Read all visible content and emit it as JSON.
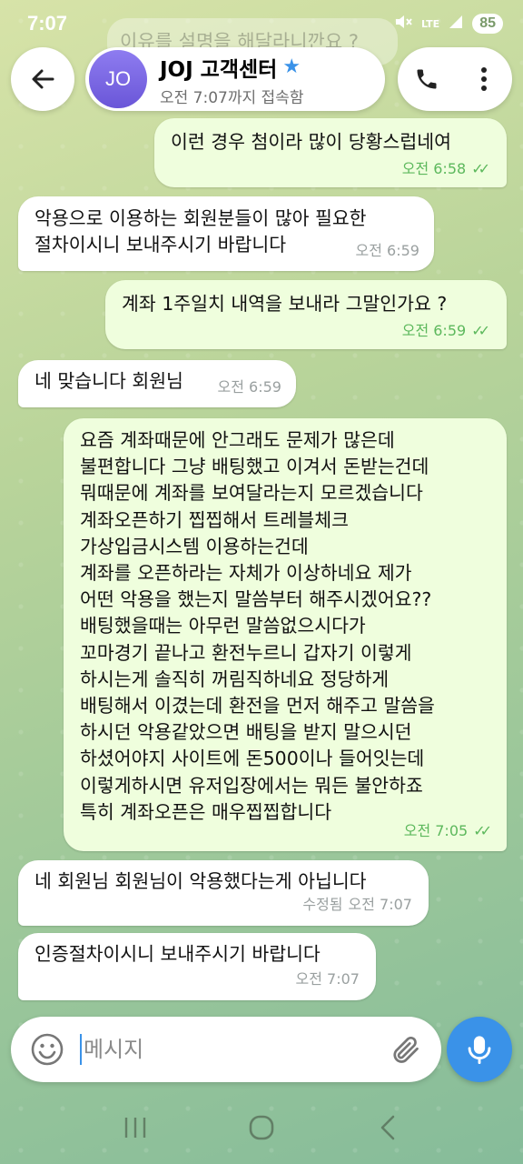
{
  "status_bar": {
    "time": "7:07",
    "network": "LTE",
    "battery": "85"
  },
  "ghost_message": "이유를 설명을 해달라니깐요 ?",
  "header": {
    "avatar_initials": "JO",
    "chat_name": "JOJ 고객센터",
    "chat_status": "오전 7:07까지 접속함",
    "icons": {
      "back": "back-arrow-icon",
      "verified": "star-icon",
      "call": "phone-icon",
      "menu": "more-vertical-icon"
    }
  },
  "messages": [
    {
      "direction": "out",
      "text": "이런 경우 첨이라 많이 당황스럽네여",
      "time": "오전 6:58",
      "read": true
    },
    {
      "direction": "in",
      "text": "악용으로 이용하는 회원분들이 많아 필요한\n절차이시니 보내주시기 바랍니다",
      "time": "오전 6:59"
    },
    {
      "direction": "out",
      "text": "계좌 1주일치 내역을 보내라 그말인가요 ?",
      "time": "오전 6:59",
      "read": true
    },
    {
      "direction": "in",
      "text": "네 맞습니다 회원님",
      "time": "오전 6:59"
    },
    {
      "direction": "out",
      "text": "요즘 계좌때문에 안그래도 문제가 많은데\n불편합니다 그냥 배팅했고 이겨서 돈받는건데\n뭐때문에 계좌를 보여달라는지 모르겠습니다\n계좌오픈하기 찝찝해서 트레블체크\n가상입금시스템 이용하는건데\n계좌를 오픈하라는 자체가 이상하네요 제가\n어떤 악용을 했는지 말씀부터 해주시겠어요??\n배팅했을때는 아무런 말씀없으시다가\n꼬마경기 끝나고 환전누르니 갑자기 이렇게\n하시는게 솔직히 꺼림직하네요 정당하게\n배팅해서 이겼는데 환전을 먼저 해주고 말씀을\n하시던 악용같았으면 배팅을 받지 말으시던\n하셨어야지 사이트에 돈500이나 들어잇는데\n이렇게하시면 유저입장에서는 뭐든 불안하죠\n특히 계좌오픈은 매우찝찝합니다",
      "time": "오전 7:05",
      "read": true
    },
    {
      "direction": "in",
      "text": "네 회원님 회원님이 악용했다는게 아닙니다",
      "time": "오전 7:07",
      "edited_label": "수정됨"
    },
    {
      "direction": "in",
      "text": "인증절차이시니 보내주시기 바랍니다",
      "time": "오전 7:07"
    }
  ],
  "composer": {
    "placeholder": "메시지",
    "icons": {
      "emoji": "emoji-icon",
      "attach": "paperclip-icon",
      "mic": "microphone-icon"
    }
  },
  "nav_bar": {
    "icons": [
      "recent-apps-icon",
      "home-icon",
      "back-icon"
    ]
  },
  "colors": {
    "accent": "#3a92e8",
    "outgoing_bubble": "#effedd",
    "incoming_bubble": "#ffffff",
    "read_ticks": "#5cb85c",
    "avatar": "#7a68e4"
  }
}
